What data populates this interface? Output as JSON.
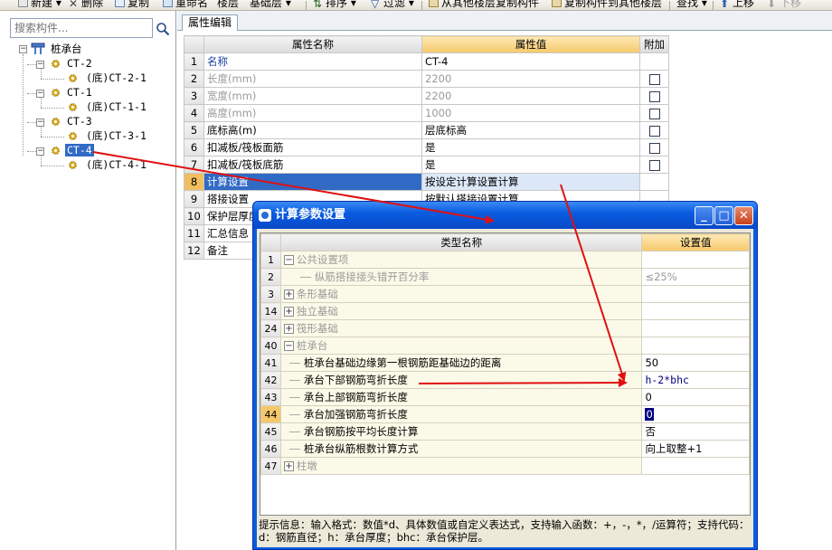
{
  "toolbar": {
    "items": [
      "新建",
      "删除",
      "复制",
      "重命名",
      "楼层",
      "基础层",
      "排序",
      "过滤",
      "从其他楼层复制构件",
      "复制构件到其他楼层",
      "查找",
      "上移",
      "下移"
    ]
  },
  "left": {
    "search_placeholder": "搜索构件...",
    "tree": {
      "root": "桩承台",
      "groups": [
        {
          "name": "CT-2",
          "child": "(底)CT-2-1"
        },
        {
          "name": "CT-1",
          "child": "(底)CT-1-1"
        },
        {
          "name": "CT-3",
          "child": "(底)CT-3-1"
        },
        {
          "name": "CT-4",
          "child": "(底)CT-4-1"
        }
      ]
    }
  },
  "props": {
    "tab": "属性编辑",
    "headers": [
      "属性名称",
      "属性值",
      "附加"
    ],
    "rows": [
      {
        "n": "1",
        "name": "名称",
        "value": "CT-4"
      },
      {
        "n": "2",
        "name": "长度(mm)",
        "value": "2200"
      },
      {
        "n": "3",
        "name": "宽度(mm)",
        "value": "2200"
      },
      {
        "n": "4",
        "name": "高度(mm)",
        "value": "1000"
      },
      {
        "n": "5",
        "name": "底标高(m)",
        "value": "层底标高"
      },
      {
        "n": "6",
        "name": "扣减板/筏板面筋",
        "value": "是"
      },
      {
        "n": "7",
        "name": "扣减板/筏板底筋",
        "value": "是"
      },
      {
        "n": "8",
        "name": "计算设置",
        "value": "按设定计算设置计算"
      },
      {
        "n": "9",
        "name": "搭接设置",
        "value": "按默认搭接设置计算"
      },
      {
        "n": "10",
        "name": "保护层厚度",
        "value": ""
      },
      {
        "n": "11",
        "name": "汇总信息",
        "value": ""
      },
      {
        "n": "12",
        "name": "备注",
        "value": ""
      }
    ]
  },
  "dialog": {
    "title": "计算参数设置",
    "headers": [
      "类型名称",
      "设置值"
    ],
    "rows": [
      {
        "n": "1",
        "name": "公共设置项",
        "value": ""
      },
      {
        "n": "2",
        "name": "纵筋搭接接头错开百分率",
        "value": "≤25%"
      },
      {
        "n": "3",
        "name": "条形基础",
        "value": ""
      },
      {
        "n": "14",
        "name": "独立基础",
        "value": ""
      },
      {
        "n": "24",
        "name": "筏形基础",
        "value": ""
      },
      {
        "n": "40",
        "name": "桩承台",
        "value": ""
      },
      {
        "n": "41",
        "name": "桩承台基础边缘第一根钢筋距基础边的距离",
        "value": "50"
      },
      {
        "n": "42",
        "name": "承台下部钢筋弯折长度",
        "value": "h-2*bhc"
      },
      {
        "n": "43",
        "name": "承台上部钢筋弯折长度",
        "value": "0"
      },
      {
        "n": "44",
        "name": "承台加强钢筋弯折长度",
        "value": "0"
      },
      {
        "n": "45",
        "name": "承台钢筋按平均长度计算",
        "value": "否"
      },
      {
        "n": "46",
        "name": "桩承台纵筋根数计算方式",
        "value": "向上取整+1"
      },
      {
        "n": "47",
        "name": "柱墩",
        "value": ""
      }
    ],
    "hint": "提示信息：输入格式：数值*d、具体数值或自定义表达式，支持输入函数：+，-，*，/运算符；支持代码：d：钢筋直径；h：承台厚度；bhc：承台保护层。"
  },
  "colors": {
    "selection": "#316ac5",
    "header_highlight": "#f6c86a",
    "title_bar": "#0a5ce0",
    "arrow": "#e01010"
  }
}
